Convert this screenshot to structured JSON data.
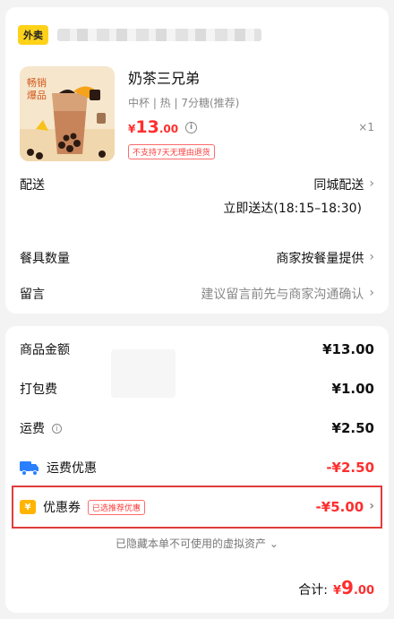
{
  "store": {
    "tag": "外卖"
  },
  "product": {
    "name": "奶茶三兄弟",
    "spec": "中杯 | 热 | 7分糖(推荐)",
    "price_currency": "¥",
    "price_int": "13",
    "price_dec": ".00",
    "qty": "×1",
    "no_return_tag": "不支持7天无理由退货",
    "image_badge": "畅销\n爆品"
  },
  "delivery": {
    "label": "配送",
    "value": "同城配送",
    "time": "立即送达(18:15–18:30)"
  },
  "utensils": {
    "label": "餐具数量",
    "value": "商家按餐量提供"
  },
  "note": {
    "label": "留言",
    "placeholder": "建议留言前先与商家沟通确认"
  },
  "pricing": {
    "goods_label": "商品金额",
    "goods_value": "¥13.00",
    "packing_label": "打包费",
    "packing_value": "¥1.00",
    "shipping_label": "运费",
    "shipping_value": "¥2.50",
    "ship_discount_label": "运费优惠",
    "ship_discount_value": "-¥2.50",
    "coupon_label": "优惠券",
    "coupon_tag": "已选推荐优惠",
    "coupon_value": "-¥5.00",
    "hidden_note": "已隐藏本单不可使用的虚拟资产",
    "total_label": "合计:",
    "total_currency": "¥",
    "total_int": "9",
    "total_dec": ".00"
  },
  "colors": {
    "accent_red": "#ff2e2e",
    "tag_yellow": "#ffd21a",
    "highlight_border": "#e23b3b"
  }
}
